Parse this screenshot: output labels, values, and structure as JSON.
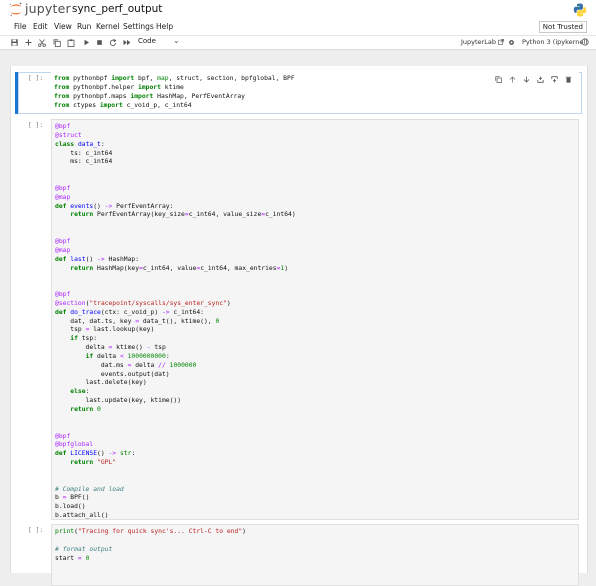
{
  "header": {
    "brand": "jupyter",
    "notebook_title": "sync_perf_output"
  },
  "menu": {
    "items": [
      "File",
      "Edit",
      "View",
      "Run",
      "Kernel",
      "Settings",
      "Help"
    ],
    "trust_status": "Not Trusted"
  },
  "toolbar": {
    "buttons": [
      "save-icon",
      "add-icon",
      "cut-icon",
      "copy-icon",
      "paste-icon",
      "run-icon",
      "stop-icon",
      "restart-icon",
      "run-all-icon"
    ],
    "cell_type": "Code",
    "jupyterlab_link": "JupyterLab",
    "kernel": "Python 3 (ipykernel)"
  },
  "cells": [
    {
      "prompt": "[ ]:",
      "selected": true,
      "lines": [
        "from pythonbpf import bpf, map, struct, section, bpfglobal, BPF",
        "from pythonbpf.helper import ktime",
        "from pythonbpf.maps import HashMap, PerfEventArray",
        "from ctypes import c_void_p, c_int64"
      ]
    },
    {
      "prompt": "[ ]:",
      "selected": false,
      "lines": [
        "@bpf",
        "@struct",
        "class data_t:",
        "    ts: c_int64",
        "    ms: c_int64",
        "",
        "",
        "@bpf",
        "@map",
        "def events() -> PerfEventArray:",
        "    return PerfEventArray(key_size=c_int64, value_size=c_int64)",
        "",
        "",
        "@bpf",
        "@map",
        "def last() -> HashMap:",
        "    return HashMap(key=c_int64, value=c_int64, max_entries=1)",
        "",
        "",
        "@bpf",
        "@section(\"tracepoint/syscalls/sys_enter_sync\")",
        "def do_trace(ctx: c_void_p) -> c_int64:",
        "    dat, dat.ts, key = data_t(), ktime(), 0",
        "    tsp = last.lookup(key)",
        "    if tsp:",
        "        delta = ktime() - tsp",
        "        if delta < 1000000000:",
        "            dat.ms = delta // 1000000",
        "            events.output(dat)",
        "        last.delete(key)",
        "    else:",
        "        last.update(key, ktime())",
        "    return 0",
        "",
        "",
        "@bpf",
        "@bpfglobal",
        "def LICENSE() -> str:",
        "    return \"GPL\"",
        "",
        "",
        "# Compile and load",
        "b = BPF()",
        "b.load()",
        "b.attach_all()"
      ]
    },
    {
      "prompt": "[ ]:",
      "selected": false,
      "lines": [
        "print(\"Tracing for quick sync's... Ctrl-C to end\")",
        "",
        "# format output",
        "start = 0"
      ]
    }
  ]
}
